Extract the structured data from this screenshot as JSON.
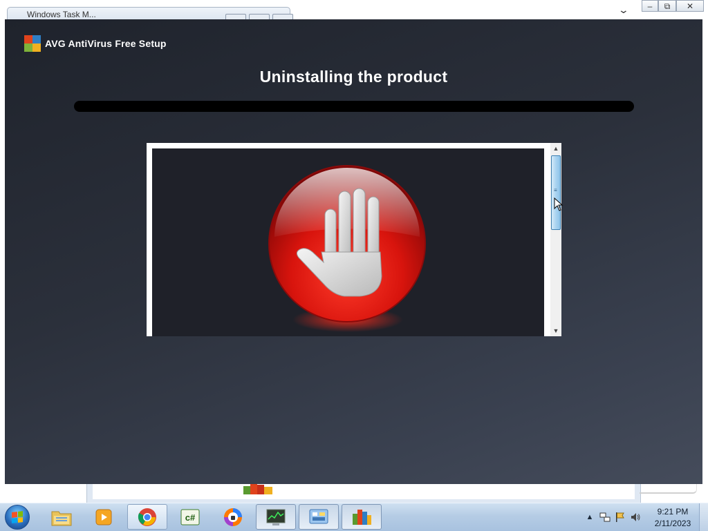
{
  "background": {
    "tab_title": "Windows Task M..."
  },
  "dialog": {
    "brand_name": "AVG AntiVirus Free Setup",
    "title": "Uninstalling the product",
    "progress_fraction": 0,
    "image": "stop-hand-icon"
  },
  "taskbar": {
    "icons": [
      "start-orb",
      "file-explorer-icon",
      "media-player-icon",
      "chrome-icon",
      "csharp-icon",
      "avast-secure-browser-icon",
      "task-manager-icon",
      "control-panel-icon",
      "avg-icon"
    ],
    "clock_time": "9:21 PM",
    "clock_date": "2/11/2023"
  },
  "colors": {
    "avg_red": "#e0431c",
    "avg_blue": "#2f7ec4",
    "avg_green": "#7fb23a",
    "avg_yellow": "#f0b020",
    "dialog_bg": "#2b303b"
  }
}
